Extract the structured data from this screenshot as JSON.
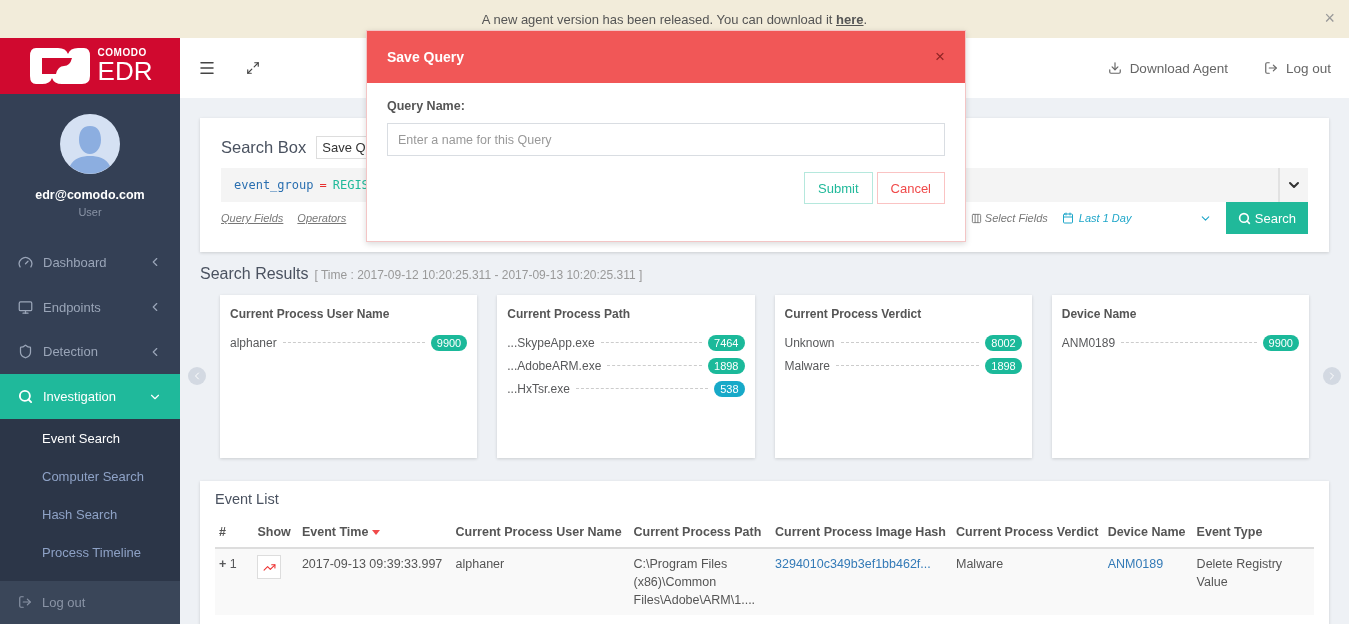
{
  "banner": {
    "text_before": "A new agent version has been released. You can download it",
    "link": "here",
    "text_after": ".",
    "close": "×"
  },
  "logo": {
    "brand": "COMODO",
    "product": "EDR"
  },
  "header": {
    "actions": [
      {
        "label": "Download Agent",
        "kind": "download"
      },
      {
        "label": "Log out",
        "kind": "logout"
      }
    ]
  },
  "sidebar": {
    "email": "edr@comodo.com",
    "role": "User",
    "items": [
      {
        "label": "Dashboard",
        "kind": "dashboard",
        "selected": false,
        "expanded": false
      },
      {
        "label": "Endpoints",
        "kind": "endpoints",
        "selected": false,
        "expanded": false
      },
      {
        "label": "Detection",
        "kind": "detection",
        "selected": false,
        "expanded": false
      },
      {
        "label": "Investigation",
        "kind": "investigation",
        "selected": true,
        "expanded": true,
        "children": [
          {
            "label": "Event Search",
            "selected": true
          },
          {
            "label": "Computer Search",
            "selected": false
          },
          {
            "label": "Hash Search",
            "selected": false
          },
          {
            "label": "Process Timeline",
            "selected": false
          }
        ]
      }
    ],
    "logout": "Log out"
  },
  "search_box": {
    "title": "Search Box",
    "save_button": "Save Q",
    "query": [
      {
        "kind": "field",
        "text": "event_group"
      },
      {
        "kind": "op",
        "text": "="
      },
      {
        "kind": "value",
        "text": "REGIS"
      }
    ],
    "links": [
      "Query Fields",
      "Operators"
    ],
    "select_fields": "Select Fields",
    "range": "Last 1 Day",
    "search_button": "Search"
  },
  "search_results": {
    "title": "Search Results",
    "time": "[ Time : 2017-09-12 10:20:25.311 - 2017-09-13 10:20:25.311 ]",
    "cards": [
      {
        "title": "Current Process User Name",
        "rows": [
          {
            "label": "alphaner",
            "count": "9900",
            "color": "#1bb99a"
          }
        ]
      },
      {
        "title": "Current Process Path",
        "rows": [
          {
            "label": "...SkypeApp.exe",
            "count": "7464",
            "color": "#1bb99a"
          },
          {
            "label": "...AdobeARM.exe",
            "count": "1898",
            "color": "#1bb99a"
          },
          {
            "label": "...HxTsr.exe",
            "count": "538",
            "color": "#17a9c8"
          }
        ]
      },
      {
        "title": "Current Process Verdict",
        "rows": [
          {
            "label": "Unknown",
            "count": "8002",
            "color": "#1bb99a"
          },
          {
            "label": "Malware",
            "count": "1898",
            "color": "#1bb99a"
          }
        ]
      },
      {
        "title": "Device Name",
        "rows": [
          {
            "label": "ANM0189",
            "count": "9900",
            "color": "#1bb99a"
          }
        ]
      }
    ]
  },
  "event_list": {
    "title": "Event List",
    "columns": [
      {
        "label": "#",
        "sorted": false
      },
      {
        "label": "Show",
        "sorted": false
      },
      {
        "label": "Event Time",
        "sorted": true
      },
      {
        "label": "Current Process User Name",
        "sorted": false
      },
      {
        "label": "Current Process Path",
        "sorted": false
      },
      {
        "label": "Current Process Image Hash",
        "sorted": false
      },
      {
        "label": "Current Process Verdict",
        "sorted": false
      },
      {
        "label": "Device Name",
        "sorted": false
      },
      {
        "label": "Event Type",
        "sorted": false
      }
    ],
    "rows": [
      {
        "cells": [
          {
            "kind": "index",
            "expander": "+",
            "text": "1"
          },
          {
            "kind": "show",
            "text": ""
          },
          {
            "kind": "text",
            "text": "2017-09-13 09:39:33.997"
          },
          {
            "kind": "text",
            "text": "alphaner"
          },
          {
            "kind": "text",
            "text": "C:\\Program Files (x86)\\Common Files\\Adobe\\ARM\\1...."
          },
          {
            "kind": "link",
            "text": "3294010c349b3ef1bb462f..."
          },
          {
            "kind": "text",
            "text": "Malware"
          },
          {
            "kind": "link",
            "text": "ANM0189"
          },
          {
            "kind": "text",
            "text": "Delete Registry Value"
          }
        ]
      }
    ]
  },
  "modal": {
    "title": "Save Query",
    "close": "×",
    "label": "Query Name:",
    "placeholder": "Enter a name for this Query",
    "submit": "Submit",
    "cancel": "Cancel"
  }
}
